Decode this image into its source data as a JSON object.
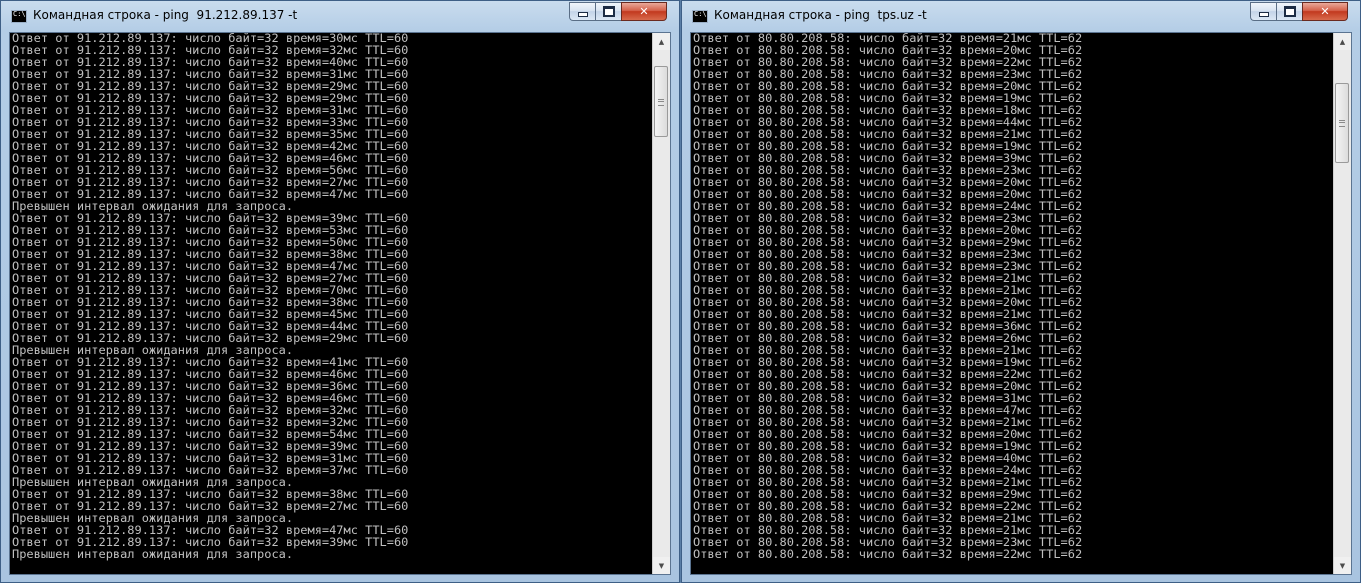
{
  "left_window": {
    "title": "Командная строка - ping  91.212.89.137 -t",
    "lines": [
      "Ответ от 91.212.89.137: число байт=32 время=30мс TTL=60",
      "Ответ от 91.212.89.137: число байт=32 время=32мс TTL=60",
      "Ответ от 91.212.89.137: число байт=32 время=40мс TTL=60",
      "Ответ от 91.212.89.137: число байт=32 время=31мс TTL=60",
      "Ответ от 91.212.89.137: число байт=32 время=29мс TTL=60",
      "Ответ от 91.212.89.137: число байт=32 время=29мс TTL=60",
      "Ответ от 91.212.89.137: число байт=32 время=31мс TTL=60",
      "Ответ от 91.212.89.137: число байт=32 время=33мс TTL=60",
      "Ответ от 91.212.89.137: число байт=32 время=35мс TTL=60",
      "Ответ от 91.212.89.137: число байт=32 время=42мс TTL=60",
      "Ответ от 91.212.89.137: число байт=32 время=46мс TTL=60",
      "Ответ от 91.212.89.137: число байт=32 время=56мс TTL=60",
      "Ответ от 91.212.89.137: число байт=32 время=27мс TTL=60",
      "Ответ от 91.212.89.137: число байт=32 время=47мс TTL=60",
      "Превышен интервал ожидания для запроса.",
      "Ответ от 91.212.89.137: число байт=32 время=39мс TTL=60",
      "Ответ от 91.212.89.137: число байт=32 время=53мс TTL=60",
      "Ответ от 91.212.89.137: число байт=32 время=50мс TTL=60",
      "Ответ от 91.212.89.137: число байт=32 время=38мс TTL=60",
      "Ответ от 91.212.89.137: число байт=32 время=47мс TTL=60",
      "Ответ от 91.212.89.137: число байт=32 время=27мс TTL=60",
      "Ответ от 91.212.89.137: число байт=32 время=70мс TTL=60",
      "Ответ от 91.212.89.137: число байт=32 время=38мс TTL=60",
      "Ответ от 91.212.89.137: число байт=32 время=45мс TTL=60",
      "Ответ от 91.212.89.137: число байт=32 время=44мс TTL=60",
      "Ответ от 91.212.89.137: число байт=32 время=29мс TTL=60",
      "Превышен интервал ожидания для запроса.",
      "Ответ от 91.212.89.137: число байт=32 время=41мс TTL=60",
      "Ответ от 91.212.89.137: число байт=32 время=46мс TTL=60",
      "Ответ от 91.212.89.137: число байт=32 время=36мс TTL=60",
      "Ответ от 91.212.89.137: число байт=32 время=46мс TTL=60",
      "Ответ от 91.212.89.137: число байт=32 время=32мс TTL=60",
      "Ответ от 91.212.89.137: число байт=32 время=32мс TTL=60",
      "Ответ от 91.212.89.137: число байт=32 время=54мс TTL=60",
      "Ответ от 91.212.89.137: число байт=32 время=39мс TTL=60",
      "Ответ от 91.212.89.137: число байт=32 время=31мс TTL=60",
      "Ответ от 91.212.89.137: число байт=32 время=37мс TTL=60",
      "Превышен интервал ожидания для запроса.",
      "Ответ от 91.212.89.137: число байт=32 время=38мс TTL=60",
      "Ответ от 91.212.89.137: число байт=32 время=27мс TTL=60",
      "Превышен интервал ожидания для запроса.",
      "Ответ от 91.212.89.137: число байт=32 время=47мс TTL=60",
      "Ответ от 91.212.89.137: число байт=32 время=39мс TTL=60",
      "Превышен интервал ожидания для запроса."
    ]
  },
  "right_window": {
    "title": "Командная строка - ping  tps.uz -t",
    "lines": [
      "Ответ от 80.80.208.58: число байт=32 время=21мс TTL=62",
      "Ответ от 80.80.208.58: число байт=32 время=20мс TTL=62",
      "Ответ от 80.80.208.58: число байт=32 время=22мс TTL=62",
      "Ответ от 80.80.208.58: число байт=32 время=23мс TTL=62",
      "Ответ от 80.80.208.58: число байт=32 время=20мс TTL=62",
      "Ответ от 80.80.208.58: число байт=32 время=19мс TTL=62",
      "Ответ от 80.80.208.58: число байт=32 время=18мс TTL=62",
      "Ответ от 80.80.208.58: число байт=32 время=44мс TTL=62",
      "Ответ от 80.80.208.58: число байт=32 время=21мс TTL=62",
      "Ответ от 80.80.208.58: число байт=32 время=19мс TTL=62",
      "Ответ от 80.80.208.58: число байт=32 время=39мс TTL=62",
      "Ответ от 80.80.208.58: число байт=32 время=23мс TTL=62",
      "Ответ от 80.80.208.58: число байт=32 время=20мс TTL=62",
      "Ответ от 80.80.208.58: число байт=32 время=20мс TTL=62",
      "Ответ от 80.80.208.58: число байт=32 время=24мс TTL=62",
      "Ответ от 80.80.208.58: число байт=32 время=23мс TTL=62",
      "Ответ от 80.80.208.58: число байт=32 время=20мс TTL=62",
      "Ответ от 80.80.208.58: число байт=32 время=29мс TTL=62",
      "Ответ от 80.80.208.58: число байт=32 время=23мс TTL=62",
      "Ответ от 80.80.208.58: число байт=32 время=23мс TTL=62",
      "Ответ от 80.80.208.58: число байт=32 время=21мс TTL=62",
      "Ответ от 80.80.208.58: число байт=32 время=21мс TTL=62",
      "Ответ от 80.80.208.58: число байт=32 время=20мс TTL=62",
      "Ответ от 80.80.208.58: число байт=32 время=21мс TTL=62",
      "Ответ от 80.80.208.58: число байт=32 время=36мс TTL=62",
      "Ответ от 80.80.208.58: число байт=32 время=26мс TTL=62",
      "Ответ от 80.80.208.58: число байт=32 время=21мс TTL=62",
      "Ответ от 80.80.208.58: число байт=32 время=19мс TTL=62",
      "Ответ от 80.80.208.58: число байт=32 время=22мс TTL=62",
      "Ответ от 80.80.208.58: число байт=32 время=20мс TTL=62",
      "Ответ от 80.80.208.58: число байт=32 время=31мс TTL=62",
      "Ответ от 80.80.208.58: число байт=32 время=47мс TTL=62",
      "Ответ от 80.80.208.58: число байт=32 время=21мс TTL=62",
      "Ответ от 80.80.208.58: число байт=32 время=20мс TTL=62",
      "Ответ от 80.80.208.58: число байт=32 время=19мс TTL=62",
      "Ответ от 80.80.208.58: число байт=32 время=40мс TTL=62",
      "Ответ от 80.80.208.58: число байт=32 время=24мс TTL=62",
      "Ответ от 80.80.208.58: число байт=32 время=21мс TTL=62",
      "Ответ от 80.80.208.58: число байт=32 время=29мс TTL=62",
      "Ответ от 80.80.208.58: число байт=32 время=22мс TTL=62",
      "Ответ от 80.80.208.58: число байт=32 время=21мс TTL=62",
      "Ответ от 80.80.208.58: число байт=32 время=21мс TTL=62",
      "Ответ от 80.80.208.58: число байт=32 время=23мс TTL=62",
      "Ответ от 80.80.208.58: число байт=32 время=22мс TTL=62"
    ]
  },
  "icons": {
    "app": "cmd-icon",
    "minimize": "minimize-icon",
    "maximize": "maximize-icon",
    "close": "close-icon"
  },
  "colors": {
    "console_bg": "#000000",
    "console_text": "#c0c0c0",
    "titlebar": "#b4cde6",
    "close_button": "#c2381e"
  }
}
